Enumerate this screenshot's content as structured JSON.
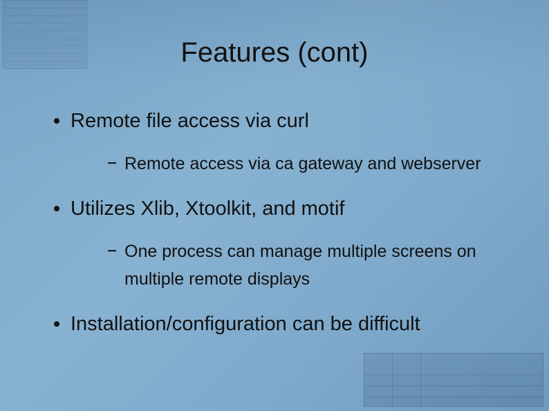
{
  "title": "Features (cont)",
  "bullets": {
    "b1": "Remote file access via curl",
    "b1_1": "Remote access via ca gateway and webserver",
    "b2": "Utilizes Xlib, Xtoolkit, and motif",
    "b2_1": "One process can manage multiple screens on multiple remote displays",
    "b3": "Installation/configuration can be difficult"
  }
}
